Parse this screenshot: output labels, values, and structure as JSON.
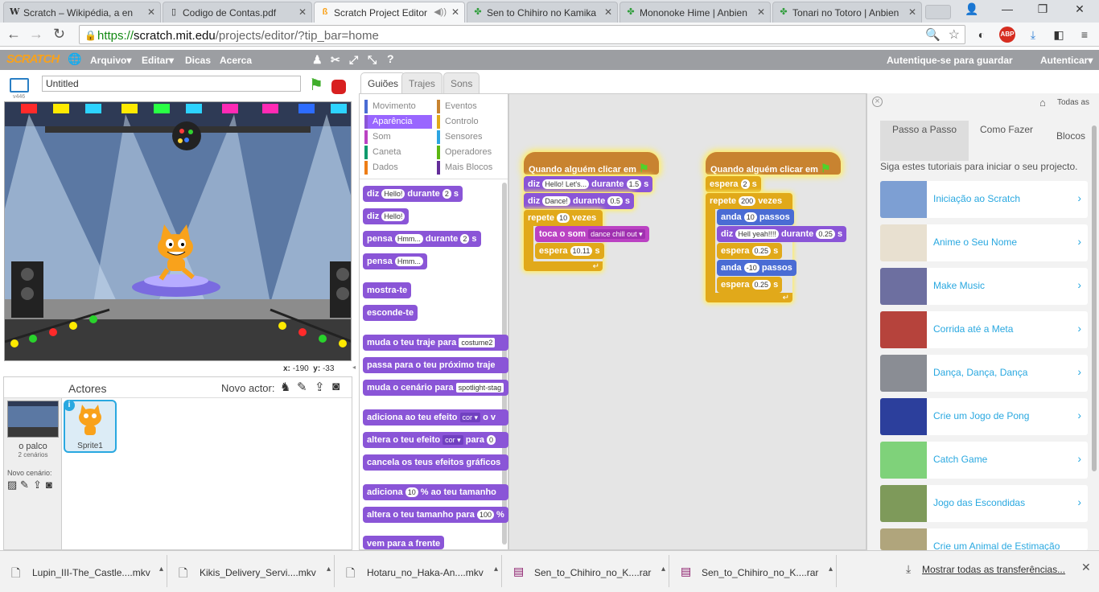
{
  "browser": {
    "tabs": [
      {
        "title": "Scratch – Wikipédia, a en",
        "icon": "wikipedia-icon"
      },
      {
        "title": "Codigo de Contas.pdf",
        "icon": "document-icon"
      },
      {
        "title": "Scratch Project Editor",
        "icon": "scratch-cat-icon",
        "active": true
      },
      {
        "title": "Sen to Chihiro no Kamika",
        "icon": "clover-icon"
      },
      {
        "title": "Mononoke Hime | Anbien",
        "icon": "clover-icon"
      },
      {
        "title": "Tonari no Totoro | Anbien",
        "icon": "clover-icon"
      }
    ],
    "url_https": "https://",
    "url_host": "scratch.mit.edu",
    "url_path": "/projects/editor/?tip_bar=home",
    "adblock": "ABP"
  },
  "menu": {
    "logo": "SCRATCH",
    "file": "Arquivo▾",
    "edit": "Editar▾",
    "tips": "Dicas",
    "about": "Acerca",
    "login_to_save": "Autentique-se para guardar",
    "login": "Autenticar▾"
  },
  "stage": {
    "project_title": "Untitled",
    "version": "v446",
    "coords_x_label": "x:",
    "coords_x": "-190",
    "coords_y_label": "y:",
    "coords_y": "-33"
  },
  "sprites": {
    "header": "Actores",
    "new_sprite": "Novo actor:",
    "stage_label": "o palco",
    "stage_backdrops": "2 cenários",
    "new_backdrop": "Novo cenário:",
    "sprite1": "Sprite1"
  },
  "editor_tabs": [
    "Guiões",
    "Trajes",
    "Sons"
  ],
  "categories": [
    {
      "label": "Movimento",
      "color": "#4a6cd4"
    },
    {
      "label": "Eventos",
      "color": "#c88330"
    },
    {
      "label": "Aparência",
      "color": "#8a55d7",
      "active": true
    },
    {
      "label": "Controlo",
      "color": "#e1a91a"
    },
    {
      "label": "Som",
      "color": "#bb42c3"
    },
    {
      "label": "Sensores",
      "color": "#2ca5e2"
    },
    {
      "label": "Caneta",
      "color": "#0e9a6c"
    },
    {
      "label": "Operadores",
      "color": "#5cb712"
    },
    {
      "label": "Dados",
      "color": "#ee7d16"
    },
    {
      "label": "Mais Blocos",
      "color": "#632d99"
    }
  ],
  "palette_blocks": [
    {
      "pre": "diz",
      "inp": "Hello!",
      "post": "durante",
      "inp2": "2",
      "post2": "s"
    },
    {
      "pre": "diz",
      "inp": "Hello!"
    },
    {
      "pre": "pensa",
      "inp": "Hmm...",
      "post": "durante",
      "inp2": "2",
      "post2": "s"
    },
    {
      "pre": "pensa",
      "inp": "Hmm..."
    },
    {
      "pre": "mostra-te"
    },
    {
      "pre": "esconde-te"
    },
    {
      "pre": "muda o teu traje para",
      "inp": "costume2"
    },
    {
      "pre": "passa para o teu próximo traje"
    },
    {
      "pre": "muda o cenário para",
      "inp": "spotlight-stag"
    },
    {
      "pre": "adiciona ao teu efeito",
      "inp": "cor ▾",
      "post": "o v"
    },
    {
      "pre": "altera o teu efeito",
      "inp": "cor ▾",
      "post": "para",
      "inp2": "0"
    },
    {
      "pre": "cancela os teus efeitos gráficos"
    },
    {
      "pre": "adiciona",
      "inp": "10",
      "post": "% ao teu tamanho"
    },
    {
      "pre": "altera o teu tamanho para",
      "inp": "100",
      "post": "%"
    },
    {
      "pre": "vem para a frente"
    }
  ],
  "script1": {
    "hat": "Quando alguém clicar em",
    "b1": {
      "pre": "diz",
      "inp": "Hello! Let's...",
      "post": "durante",
      "inp2": "1.5",
      "post2": "s"
    },
    "b2": {
      "pre": "diz",
      "inp": "Dance!",
      "post": "durante",
      "inp2": "0.5",
      "post2": "s"
    },
    "repeat": {
      "pre": "repete",
      "inp": "10",
      "post": "vezes"
    },
    "b3": {
      "pre": "toca o som",
      "inp": "dance chill out ▾"
    },
    "b4": {
      "pre": "espera",
      "inp": "10.11",
      "post": "s"
    }
  },
  "script2": {
    "hat": "Quando alguém clicar em",
    "b1": {
      "pre": "espera",
      "inp": "2",
      "post": "s"
    },
    "repeat": {
      "pre": "repete",
      "inp": "200",
      "post": "vezes"
    },
    "b2": {
      "pre": "anda",
      "inp": "10",
      "post": "passos"
    },
    "b3": {
      "pre": "diz",
      "inp": "Hell yeah!!!!",
      "post": "durante",
      "inp2": "0.25",
      "post2": "s"
    },
    "b4": {
      "pre": "espera",
      "inp": "0.25",
      "post": "s"
    },
    "b5": {
      "pre": "anda",
      "inp": "-10",
      "post": "passos"
    },
    "b6": {
      "pre": "espera",
      "inp": "0.25",
      "post": "s"
    }
  },
  "tips": {
    "all": "Todas as",
    "nav": [
      "Passo a Passo",
      "Como Fazer",
      "Blocos"
    ],
    "intro": "Siga estes tutoriais para iniciar o seu projecto.",
    "items": [
      "Iniciação ao Scratch",
      "Anime o Seu Nome",
      "Make Music",
      "Corrida até a Meta",
      "Dança, Dança, Dança",
      "Crie um Jogo de Pong",
      "Catch Game",
      "Jogo das Escondidas",
      "Crie um Animal de Estimação"
    ]
  },
  "downloads": {
    "items": [
      {
        "name": "Lupin_III-The_Castle....mkv",
        "icon": "file-icon"
      },
      {
        "name": "Kikis_Delivery_Servi....mkv",
        "icon": "file-icon"
      },
      {
        "name": "Hotaru_no_Haka-An....mkv",
        "icon": "file-icon"
      },
      {
        "name": "Sen_to_Chihiro_no_K....rar",
        "icon": "archive-icon"
      },
      {
        "name": "Sen_to_Chihiro_no_K....rar",
        "icon": "archive-icon"
      }
    ],
    "show_all": "Mostrar todas as transferências..."
  }
}
